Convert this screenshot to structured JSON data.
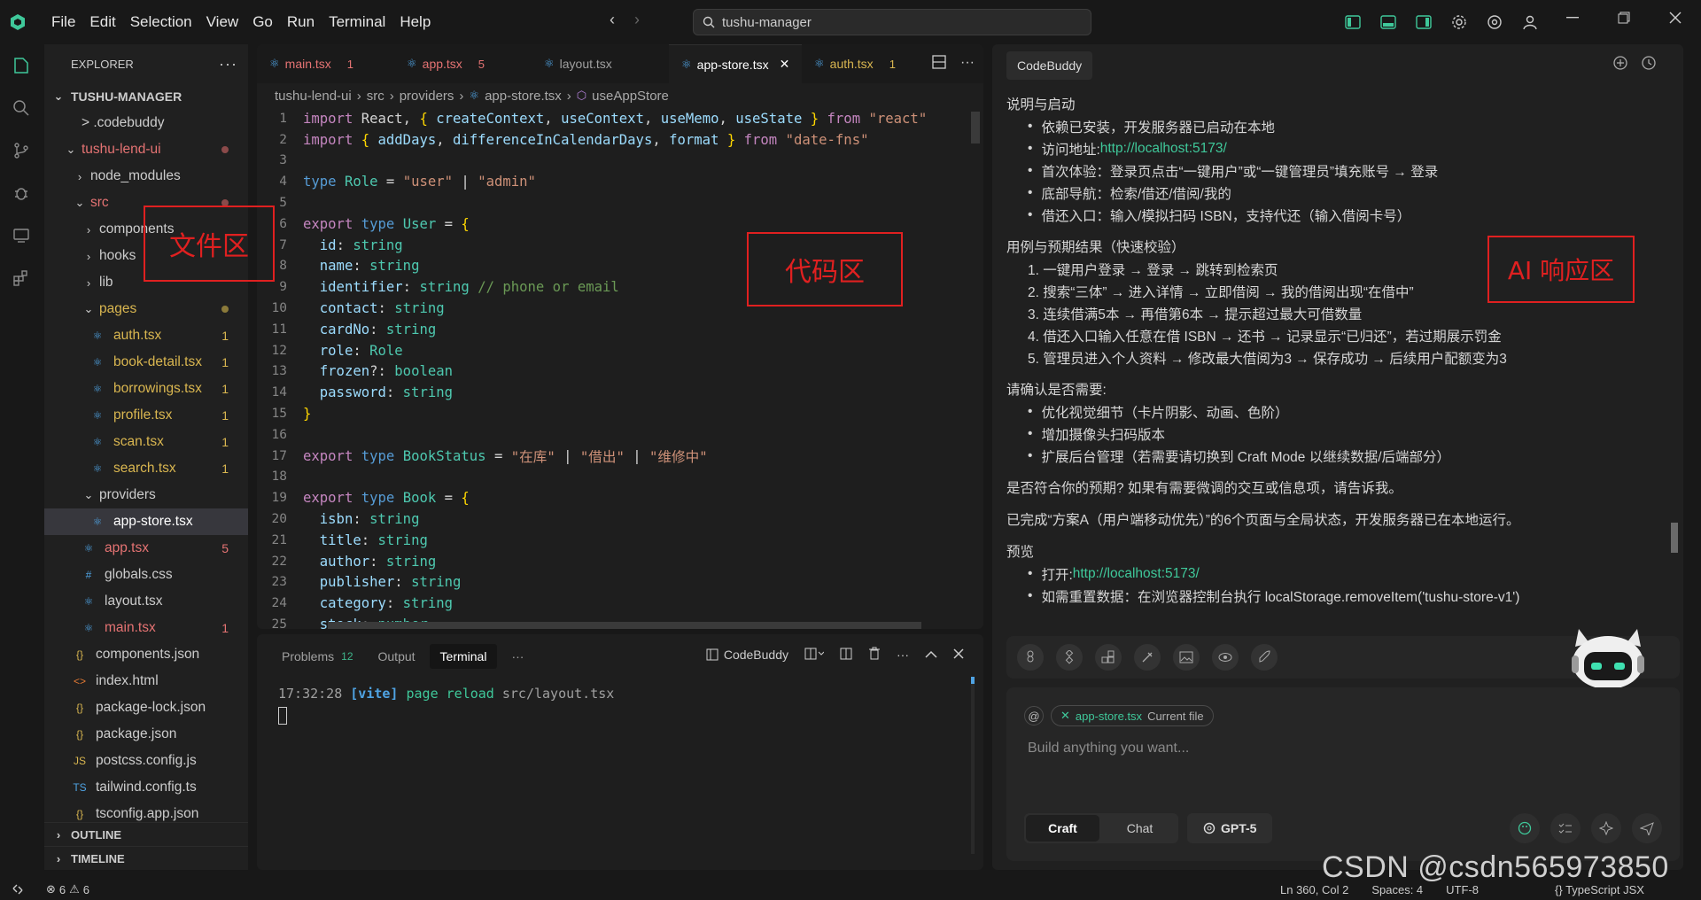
{
  "menu": {
    "file": "File",
    "edit": "Edit",
    "selection": "Selection",
    "view": "View",
    "go": "Go",
    "run": "Run",
    "terminal": "Terminal",
    "help": "Help"
  },
  "search": {
    "value": "tushu-manager"
  },
  "explorer": {
    "title": "EXPLORER",
    "root": "TUSHU-MANAGER",
    "items": [
      {
        "label": "> .codebuddy",
        "level": 1,
        "kind": "folder",
        "color": "#cccccc",
        "badge": "",
        "dot": ""
      },
      {
        "label": "tushu-lend-ui",
        "level": 1,
        "kind": "folder-open",
        "color": "#e57373",
        "badge": "",
        "dot": "#8b4a4a"
      },
      {
        "label": "node_modules",
        "level": 2,
        "kind": "folder",
        "color": "#cccccc",
        "badge": "",
        "dot": ""
      },
      {
        "label": "src",
        "level": 2,
        "kind": "folder-open",
        "color": "#e57373",
        "badge": "",
        "dot": "#8b4a4a"
      },
      {
        "label": "components",
        "level": 3,
        "kind": "folder",
        "color": "#cccccc",
        "badge": "",
        "dot": ""
      },
      {
        "label": "hooks",
        "level": 3,
        "kind": "folder",
        "color": "#cccccc",
        "badge": "",
        "dot": ""
      },
      {
        "label": "lib",
        "level": 3,
        "kind": "folder",
        "color": "#cccccc",
        "badge": "",
        "dot": ""
      },
      {
        "label": "pages",
        "level": 3,
        "kind": "folder-open",
        "color": "#d9b650",
        "badge": "",
        "dot": "#8b7a3a"
      },
      {
        "label": "auth.tsx",
        "level": 4,
        "kind": "tsx",
        "color": "#d9b650",
        "badge": "1",
        "dot": ""
      },
      {
        "label": "book-detail.tsx",
        "level": 4,
        "kind": "tsx",
        "color": "#d9b650",
        "badge": "1",
        "dot": ""
      },
      {
        "label": "borrowings.tsx",
        "level": 4,
        "kind": "tsx",
        "color": "#d9b650",
        "badge": "1",
        "dot": ""
      },
      {
        "label": "profile.tsx",
        "level": 4,
        "kind": "tsx",
        "color": "#d9b650",
        "badge": "1",
        "dot": ""
      },
      {
        "label": "scan.tsx",
        "level": 4,
        "kind": "tsx",
        "color": "#d9b650",
        "badge": "1",
        "dot": ""
      },
      {
        "label": "search.tsx",
        "level": 4,
        "kind": "tsx",
        "color": "#d9b650",
        "badge": "1",
        "dot": ""
      },
      {
        "label": "providers",
        "level": 3,
        "kind": "folder-open",
        "color": "#cccccc",
        "badge": "",
        "dot": ""
      },
      {
        "label": "app-store.tsx",
        "level": 4,
        "kind": "tsx",
        "color": "#ffffff",
        "badge": "",
        "dot": "",
        "selected": true
      },
      {
        "label": "app.tsx",
        "level": 3,
        "kind": "tsx",
        "color": "#e57373",
        "badge": "5",
        "dot": ""
      },
      {
        "label": "globals.css",
        "level": 3,
        "kind": "css",
        "color": "#cccccc",
        "badge": "",
        "dot": ""
      },
      {
        "label": "layout.tsx",
        "level": 3,
        "kind": "tsx",
        "color": "#cccccc",
        "badge": "",
        "dot": ""
      },
      {
        "label": "main.tsx",
        "level": 3,
        "kind": "tsx",
        "color": "#e57373",
        "badge": "1",
        "dot": ""
      },
      {
        "label": "components.json",
        "level": 2,
        "kind": "json",
        "color": "#cccccc",
        "badge": "",
        "dot": ""
      },
      {
        "label": "index.html",
        "level": 2,
        "kind": "html",
        "color": "#cccccc",
        "badge": "",
        "dot": ""
      },
      {
        "label": "package-lock.json",
        "level": 2,
        "kind": "json",
        "color": "#cccccc",
        "badge": "",
        "dot": ""
      },
      {
        "label": "package.json",
        "level": 2,
        "kind": "json",
        "color": "#cccccc",
        "badge": "",
        "dot": ""
      },
      {
        "label": "postcss.config.js",
        "level": 2,
        "kind": "js",
        "color": "#cccccc",
        "badge": "",
        "dot": ""
      },
      {
        "label": "tailwind.config.ts",
        "level": 2,
        "kind": "ts",
        "color": "#cccccc",
        "badge": "",
        "dot": ""
      },
      {
        "label": "tsconfig.app.json",
        "level": 2,
        "kind": "json",
        "color": "#cccccc",
        "badge": "",
        "dot": ""
      }
    ],
    "outline": "OUTLINE",
    "timeline": "TIMELINE"
  },
  "editor": {
    "tabs": [
      {
        "name": "main.tsx",
        "badge": "1",
        "color": "#e57373",
        "active": false
      },
      {
        "name": "app.tsx",
        "badge": "5",
        "color": "#e57373",
        "active": false
      },
      {
        "name": "layout.tsx",
        "badge": "",
        "color": "#a0a0a0",
        "active": false
      },
      {
        "name": "app-store.tsx",
        "badge": "",
        "color": "#ffffff",
        "active": true
      },
      {
        "name": "auth.tsx",
        "badge": "1",
        "color": "#d9b650",
        "active": false
      }
    ],
    "breadcrumb": [
      "tushu-lend-ui",
      "src",
      "providers",
      "app-store.tsx",
      "useAppStore"
    ],
    "lines": [
      [
        [
          "kw2",
          "import"
        ],
        [
          "pl",
          " React, "
        ],
        [
          "br",
          "{"
        ],
        [
          "pl",
          " "
        ],
        [
          "id",
          "createContext"
        ],
        [
          "pl",
          ", "
        ],
        [
          "id",
          "useContext"
        ],
        [
          "pl",
          ", "
        ],
        [
          "id",
          "useMemo"
        ],
        [
          "pl",
          ", "
        ],
        [
          "id",
          "useState"
        ],
        [
          "pl",
          " "
        ],
        [
          "br",
          "}"
        ],
        [
          "pl",
          " "
        ],
        [
          "kw2",
          "from"
        ],
        [
          "pl",
          " "
        ],
        [
          "str",
          "\"react\""
        ]
      ],
      [
        [
          "kw2",
          "import"
        ],
        [
          "pl",
          " "
        ],
        [
          "br",
          "{"
        ],
        [
          "pl",
          " "
        ],
        [
          "id",
          "addDays"
        ],
        [
          "pl",
          ", "
        ],
        [
          "id",
          "differenceInCalendarDays"
        ],
        [
          "pl",
          ", "
        ],
        [
          "id",
          "format"
        ],
        [
          "pl",
          " "
        ],
        [
          "br",
          "}"
        ],
        [
          "pl",
          " "
        ],
        [
          "kw2",
          "from"
        ],
        [
          "pl",
          " "
        ],
        [
          "str",
          "\"date-fns\""
        ]
      ],
      [],
      [
        [
          "kw",
          "type"
        ],
        [
          "pl",
          " "
        ],
        [
          "ty",
          "Role"
        ],
        [
          "pl",
          " = "
        ],
        [
          "str",
          "\"user\""
        ],
        [
          "pl",
          " | "
        ],
        [
          "str",
          "\"admin\""
        ]
      ],
      [],
      [
        [
          "kw2",
          "export"
        ],
        [
          "pl",
          " "
        ],
        [
          "kw",
          "type"
        ],
        [
          "pl",
          " "
        ],
        [
          "ty",
          "User"
        ],
        [
          "pl",
          " = "
        ],
        [
          "br",
          "{"
        ]
      ],
      [
        [
          "pl",
          "  "
        ],
        [
          "id",
          "id"
        ],
        [
          "pl",
          ": "
        ],
        [
          "ty",
          "string"
        ]
      ],
      [
        [
          "pl",
          "  "
        ],
        [
          "id",
          "name"
        ],
        [
          "pl",
          ": "
        ],
        [
          "ty",
          "string"
        ]
      ],
      [
        [
          "pl",
          "  "
        ],
        [
          "id",
          "identifier"
        ],
        [
          "pl",
          ": "
        ],
        [
          "ty",
          "string"
        ],
        [
          "pl",
          " "
        ],
        [
          "cm",
          "// phone or email"
        ]
      ],
      [
        [
          "pl",
          "  "
        ],
        [
          "id",
          "contact"
        ],
        [
          "pl",
          ": "
        ],
        [
          "ty",
          "string"
        ]
      ],
      [
        [
          "pl",
          "  "
        ],
        [
          "id",
          "cardNo"
        ],
        [
          "pl",
          ": "
        ],
        [
          "ty",
          "string"
        ]
      ],
      [
        [
          "pl",
          "  "
        ],
        [
          "id",
          "role"
        ],
        [
          "pl",
          ": "
        ],
        [
          "ty",
          "Role"
        ]
      ],
      [
        [
          "pl",
          "  "
        ],
        [
          "id",
          "frozen"
        ],
        [
          "pl",
          "?: "
        ],
        [
          "ty",
          "boolean"
        ]
      ],
      [
        [
          "pl",
          "  "
        ],
        [
          "id",
          "password"
        ],
        [
          "pl",
          ": "
        ],
        [
          "ty",
          "string"
        ]
      ],
      [
        [
          "br",
          "}"
        ]
      ],
      [],
      [
        [
          "kw2",
          "export"
        ],
        [
          "pl",
          " "
        ],
        [
          "kw",
          "type"
        ],
        [
          "pl",
          " "
        ],
        [
          "ty",
          "BookStatus"
        ],
        [
          "pl",
          " = "
        ],
        [
          "str",
          "\"在库\""
        ],
        [
          "pl",
          " | "
        ],
        [
          "str",
          "\"借出\""
        ],
        [
          "pl",
          " | "
        ],
        [
          "str",
          "\"维修中\""
        ]
      ],
      [],
      [
        [
          "kw2",
          "export"
        ],
        [
          "pl",
          " "
        ],
        [
          "kw",
          "type"
        ],
        [
          "pl",
          " "
        ],
        [
          "ty",
          "Book"
        ],
        [
          "pl",
          " = "
        ],
        [
          "br",
          "{"
        ]
      ],
      [
        [
          "pl",
          "  "
        ],
        [
          "id",
          "isbn"
        ],
        [
          "pl",
          ": "
        ],
        [
          "ty",
          "string"
        ]
      ],
      [
        [
          "pl",
          "  "
        ],
        [
          "id",
          "title"
        ],
        [
          "pl",
          ": "
        ],
        [
          "ty",
          "string"
        ]
      ],
      [
        [
          "pl",
          "  "
        ],
        [
          "id",
          "author"
        ],
        [
          "pl",
          ": "
        ],
        [
          "ty",
          "string"
        ]
      ],
      [
        [
          "pl",
          "  "
        ],
        [
          "id",
          "publisher"
        ],
        [
          "pl",
          ": "
        ],
        [
          "ty",
          "string"
        ]
      ],
      [
        [
          "pl",
          "  "
        ],
        [
          "id",
          "category"
        ],
        [
          "pl",
          ": "
        ],
        [
          "ty",
          "string"
        ]
      ],
      [
        [
          "pl",
          "  "
        ],
        [
          "id",
          "stock"
        ],
        [
          "pl",
          ": "
        ],
        [
          "ty",
          "number"
        ]
      ]
    ]
  },
  "panel": {
    "tabs": [
      {
        "label": "Problems",
        "count": "12"
      },
      {
        "label": "Output",
        "count": ""
      },
      {
        "label": "Terminal",
        "count": ""
      }
    ],
    "more": "···",
    "codebuddy": "CodeBuddy",
    "terminal": {
      "time": "17:32:28",
      "tag": "[vite]",
      "msg": "page reload",
      "path": "src/layout.tsx"
    }
  },
  "ai": {
    "tab": "CodeBuddy",
    "content": [
      {
        "t": "h",
        "text": "说明与启动"
      },
      {
        "t": "b",
        "text": "依赖已安装，开发服务器已启动在本地"
      },
      {
        "t": "b",
        "text": "访问地址: ",
        "link": "http://localhost:5173/"
      },
      {
        "t": "b",
        "text": "首次体验：登录页点击“一键用户”或“一键管理员”填充账号 → 登录"
      },
      {
        "t": "b",
        "text": "底部导航：检索/借还/借阅/我的"
      },
      {
        "t": "b",
        "text": "借还入口：输入/模拟扫码 ISBN，支持代还（输入借阅卡号）"
      },
      {
        "t": "h",
        "text": "用例与预期结果（快速校验）"
      },
      {
        "t": "n",
        "text": "1. 一键用户登录 → 登录 → 跳转到检索页"
      },
      {
        "t": "n",
        "text": "2. 搜索“三体” → 进入详情 → 立即借阅 → 我的借阅出现“在借中”"
      },
      {
        "t": "n",
        "text": "3. 连续借满5本 → 再借第6本 → 提示超过最大可借数量"
      },
      {
        "t": "n",
        "text": "4. 借还入口输入任意在借 ISBN → 还书 → 记录显示“已归还”，若过期展示罚金"
      },
      {
        "t": "n",
        "text": "5. 管理员进入个人资料 → 修改最大借阅为3 → 保存成功 → 后续用户配额变为3"
      },
      {
        "t": "h",
        "text": "请确认是否需要:"
      },
      {
        "t": "b",
        "text": "优化视觉细节（卡片阴影、动画、色阶）"
      },
      {
        "t": "b",
        "text": "增加摄像头扫码版本"
      },
      {
        "t": "b",
        "text": "扩展后台管理（若需要请切换到 Craft Mode 以继续数据/后端部分）"
      },
      {
        "t": "h",
        "text": "是否符合你的预期? 如果有需要微调的交互或信息项，请告诉我。"
      },
      {
        "t": "h",
        "text": "已完成“方案A（用户端移动优先）”的6个页面与全局状态，开发服务器已在本地运行。"
      },
      {
        "t": "h",
        "text": "预览"
      },
      {
        "t": "b",
        "text": "打开: ",
        "link": "http://localhost:5173/"
      },
      {
        "t": "b",
        "text": "如需重置数据：在浏览器控制台执行 localStorage.removeItem('tushu-store-v1')"
      }
    ],
    "chip_file": "app-store.tsx",
    "chip_label": "Current file",
    "placeholder": "Build anything you want...",
    "mode_craft": "Craft",
    "mode_chat": "Chat",
    "model": "GPT-5"
  },
  "annotations": {
    "files": "文件区",
    "code": "代码区",
    "ai": "AI 响应区"
  },
  "status": {
    "errors": "6",
    "warnings": "6",
    "pos": "Ln 360, Col 2",
    "spaces": "Spaces: 4",
    "enc": "UTF-8",
    "lang": "{} TypeScript JSX"
  },
  "watermark": "CSDN @csdn565973850",
  "colors": {
    "accent": "#3fc89a",
    "error": "#e57373",
    "warning": "#d9b650",
    "annotation": "#e02020"
  }
}
